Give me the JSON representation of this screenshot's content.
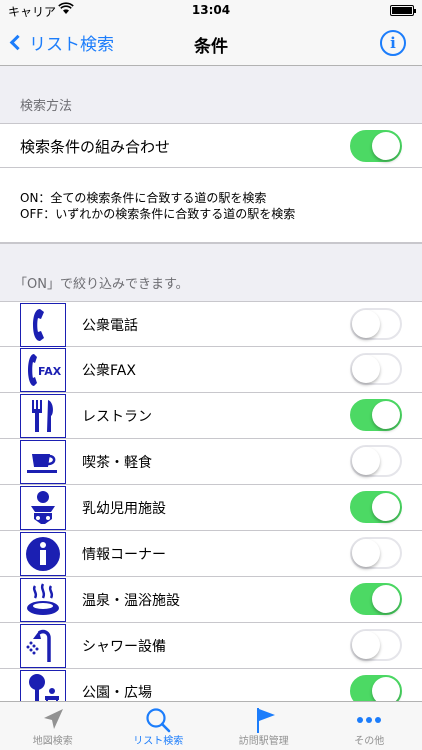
{
  "status_bar": {
    "carrier": "キャリア",
    "time": "13:04"
  },
  "nav": {
    "back_label": "リスト検索",
    "title": "条件",
    "info_label": "i"
  },
  "search_method": {
    "header": "検索方法",
    "combine_label": "検索条件の組み合わせ",
    "combine_on": true,
    "desc_on": "ON：全ての検索条件に合致する道の駅を検索",
    "desc_off": "OFF：いずれかの検索条件に合致する道の駅を検索"
  },
  "filter_header": "「ON」で絞り込みできます。",
  "facilities": [
    {
      "label": "公衆電話",
      "icon": "phone-icon",
      "on": false
    },
    {
      "label": "公衆FAX",
      "icon": "fax-icon",
      "icon_text": "FAX",
      "on": false
    },
    {
      "label": "レストラン",
      "icon": "restaurant-icon",
      "on": true
    },
    {
      "label": "喫茶・軽食",
      "icon": "cafe-icon",
      "on": false
    },
    {
      "label": "乳幼児用施設",
      "icon": "baby-icon",
      "on": true
    },
    {
      "label": "情報コーナー",
      "icon": "info-icon",
      "icon_text": "i",
      "on": false
    },
    {
      "label": "温泉・温浴施設",
      "icon": "hot-spring-icon",
      "on": true
    },
    {
      "label": "シャワー設備",
      "icon": "shower-icon",
      "on": false
    },
    {
      "label": "公園・広場",
      "icon": "park-icon",
      "on": true
    }
  ],
  "tabs": [
    {
      "label": "地図検索",
      "icon": "map-arrow-icon",
      "active": false
    },
    {
      "label": "リスト検索",
      "icon": "search-icon",
      "active": true
    },
    {
      "label": "訪問駅管理",
      "icon": "flag-icon",
      "active": false
    },
    {
      "label": "その他",
      "icon": "more-icon",
      "active": false
    }
  ],
  "colors": {
    "accent": "#1c7dfb",
    "toggle_on": "#4cd964",
    "pictogram": "#1b1fb2"
  }
}
